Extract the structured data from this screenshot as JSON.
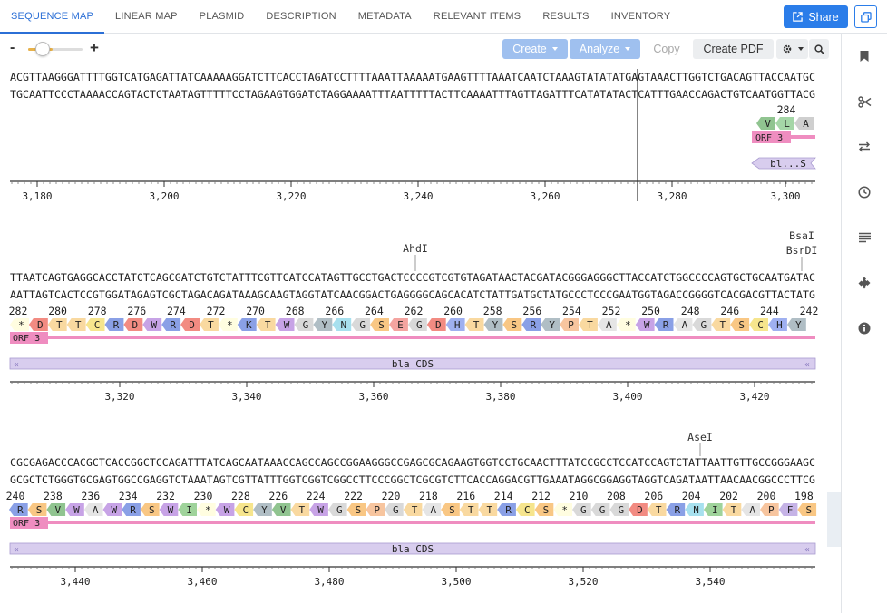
{
  "tabs": [
    {
      "label": "SEQUENCE MAP",
      "active": true
    },
    {
      "label": "LINEAR MAP"
    },
    {
      "label": "PLASMID"
    },
    {
      "label": "DESCRIPTION"
    },
    {
      "label": "METADATA"
    },
    {
      "label": "RELEVANT ITEMS"
    },
    {
      "label": "RESULTS"
    },
    {
      "label": "INVENTORY"
    }
  ],
  "share": {
    "label": "Share"
  },
  "toolbar": {
    "zoom_out": "-",
    "zoom_in": "+",
    "zoom_level": 0.45,
    "create": "Create",
    "analyze": "Analyze",
    "copy": "Copy",
    "create_pdf": "Create PDF"
  },
  "sidebar_icons": [
    "bookmark-icon",
    "scissors-icon",
    "swap-icon",
    "clock-icon",
    "text-lines-icon",
    "puzzle-icon",
    "info-icon"
  ],
  "colors": {
    "accent": "#2b7de9",
    "orf": "#ef8dc0",
    "feature": "#d8cdee"
  },
  "rows": [
    {
      "top": "ACGTTAAGGGATTTTGGTCATGAGATTATCAAAAAGGATCTTCACCTAGATCCTTTTAAATTAAAAATGAAGTTTTAAATCAATCTAAAGTATATATGAGTAAACTTGGTCTGACAGTTACCAATGC",
      "bottom": "TGCAATTCCCTAAAACCAGTACTCTAATAGTTTTTCCTAGAAGTGGATCTAGGAAAATTTAATTTTTACTTCAAAATTTAGTTAGATTTCATATATACTCATTTGAACCAGACTGTCAATGGTTACG",
      "enzymes": [],
      "aa_number": "284",
      "aa": [
        "V",
        "L",
        "A"
      ],
      "orf_label": "ORF 3",
      "feature_label": "bl...S",
      "ticks": [
        "3,180",
        "3,200",
        "3,220",
        "3,240",
        "3,260",
        "3,280",
        "3,300"
      ]
    },
    {
      "top": "TTAATCAGTGAGGCACCTATCTCAGCGATCTGTCTATTTCGTTCATCCATAGTTGCCTGACTCCCCGTCGTGTAGATAACTACGATACGGGAGGGCTTACCATCTGGCCCCAGTGCTGCAATGATAC",
      "bottom": "AATTAGTCACTCCGTGGATAGAGTCGCTAGACAGATAAAGCAAGTAGGTATCAACGGACTGAGGGGCAGCACATCTATTGATGCTATGCCCTCCCGAATGGTAGACCGGGGTCACGACGTTACTATG",
      "enzymes": [
        {
          "label": "AhdI"
        },
        {
          "label": "BsaI"
        },
        {
          "label": "BsrDI"
        }
      ],
      "aa_numbers": [
        "282",
        "280",
        "278",
        "276",
        "274",
        "272",
        "270",
        "268",
        "266",
        "264",
        "262",
        "260",
        "258",
        "256",
        "254",
        "252",
        "250",
        "248",
        "246",
        "244",
        "242"
      ],
      "aa": [
        "*",
        "D",
        "T",
        "T",
        "C",
        "R",
        "D",
        "W",
        "R",
        "D",
        "T",
        "*",
        "K",
        "T",
        "W",
        "G",
        "Y",
        "N",
        "G",
        "S",
        "E",
        "G",
        "D",
        "H",
        "T",
        "Y",
        "S",
        "R",
        "Y",
        "P",
        "T",
        "A",
        "*",
        "W",
        "R",
        "A",
        "G",
        "T",
        "S",
        "C",
        "H",
        "Y"
      ],
      "orf_label": "ORF 3",
      "feature_label": "bla CDS",
      "ticks": [
        "3,320",
        "3,340",
        "3,360",
        "3,380",
        "3,400",
        "3,420"
      ]
    },
    {
      "top": "CGCGAGACCCACGCTCACCGGCTCCAGATTTATCAGCAATAAACCAGCCAGCCGGAAGGGCCGAGCGCAGAAGTGGTCCTGCAACTTTATCCGCCTCCATCCAGTCTATTAATTGTTGCCGGGAAGC",
      "bottom": "GCGCTCTGGGTGCGAGTGGCCGAGGTCTAAATAGTCGTTATTTGGTCGGTCGGCCTTCCCGGCTCGCGTCTTCACCAGGACGTTGAAATAGGCGGAGGTAGGTCAGATAATTAACAACGGCCCTTCG",
      "enzymes": [
        {
          "label": "AseI"
        }
      ],
      "aa_numbers": [
        "240",
        "238",
        "236",
        "234",
        "232",
        "230",
        "228",
        "226",
        "224",
        "222",
        "220",
        "218",
        "216",
        "214",
        "212",
        "210",
        "208",
        "206",
        "204",
        "202",
        "200",
        "198"
      ],
      "aa": [
        "R",
        "S",
        "V",
        "W",
        "A",
        "W",
        "R",
        "S",
        "W",
        "I",
        "*",
        "W",
        "C",
        "Y",
        "V",
        "T",
        "W",
        "G",
        "S",
        "P",
        "G",
        "T",
        "A",
        "S",
        "T",
        "T",
        "R",
        "C",
        "S",
        "*",
        "G",
        "G",
        "G",
        "D",
        "T",
        "R",
        "N",
        "I",
        "T",
        "A",
        "P",
        "F",
        "S"
      ],
      "orf_label": "ORF 3",
      "feature_label": "bla CDS",
      "ticks": [
        "3,440",
        "3,460",
        "3,480",
        "3,500",
        "3,520",
        "3,540"
      ]
    }
  ]
}
